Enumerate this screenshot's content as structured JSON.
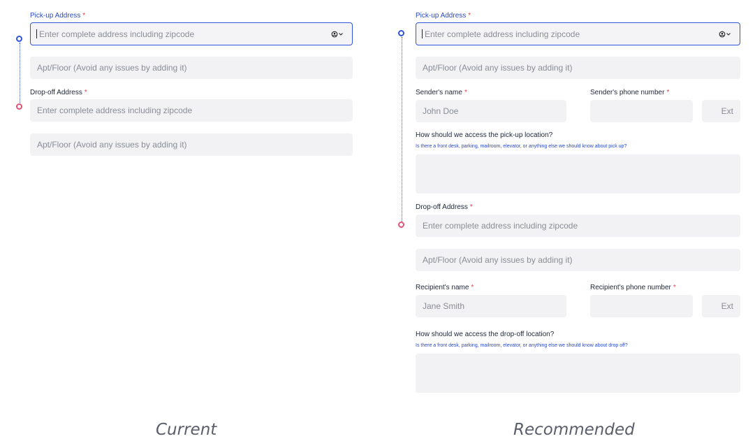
{
  "current": {
    "pickup_label": "Pick-up Address",
    "address_placeholder": "Enter complete address including zipcode",
    "apt_placeholder": "Apt/Floor (Avoid any issues by adding it)",
    "dropoff_label": "Drop-off Address",
    "dropoff_address_placeholder": "Enter complete address including zipcode",
    "dropoff_apt_placeholder": "Apt/Floor (Avoid any issues by adding it)",
    "caption": "Current"
  },
  "recommended": {
    "pickup_label": "Pick-up Address",
    "address_placeholder": "Enter complete address including zipcode",
    "apt_placeholder": "Apt/Floor (Avoid any issues by adding it)",
    "sender_name_label": "Sender's name",
    "sender_name_placeholder": "John Doe",
    "sender_phone_label": "Sender's phone number",
    "ext_placeholder": "Ext",
    "pickup_access_label": "How should we access the pick-up location?",
    "pickup_access_hint": "Is there a front desk, parking, mailroom, elevator, or anything else we should know about pick up?",
    "dropoff_label": "Drop-off Address",
    "dropoff_address_placeholder": "Enter complete address including zipcode",
    "dropoff_apt_placeholder": "Apt/Floor (Avoid any issues by adding it)",
    "recipient_name_label": "Recipient's name",
    "recipient_name_placeholder": "Jane Smith",
    "recipient_phone_label": "Recipient's phone number",
    "recipient_ext_placeholder": "Ext",
    "dropoff_access_label": "How should we access the drop-off location?",
    "dropoff_access_hint": "Is there a front desk, parking, mailroom, elevator, or anything else we should know about drop off?",
    "caption": "Recommended"
  },
  "required_mark": "*",
  "icons": {
    "location": "current-location-icon",
    "chevron": "chevron-down-icon"
  },
  "colors": {
    "accent": "#2f54d9",
    "required": "#e0414d",
    "dropoff_dot": "#e05575",
    "field_bg": "#f2f2f5"
  }
}
